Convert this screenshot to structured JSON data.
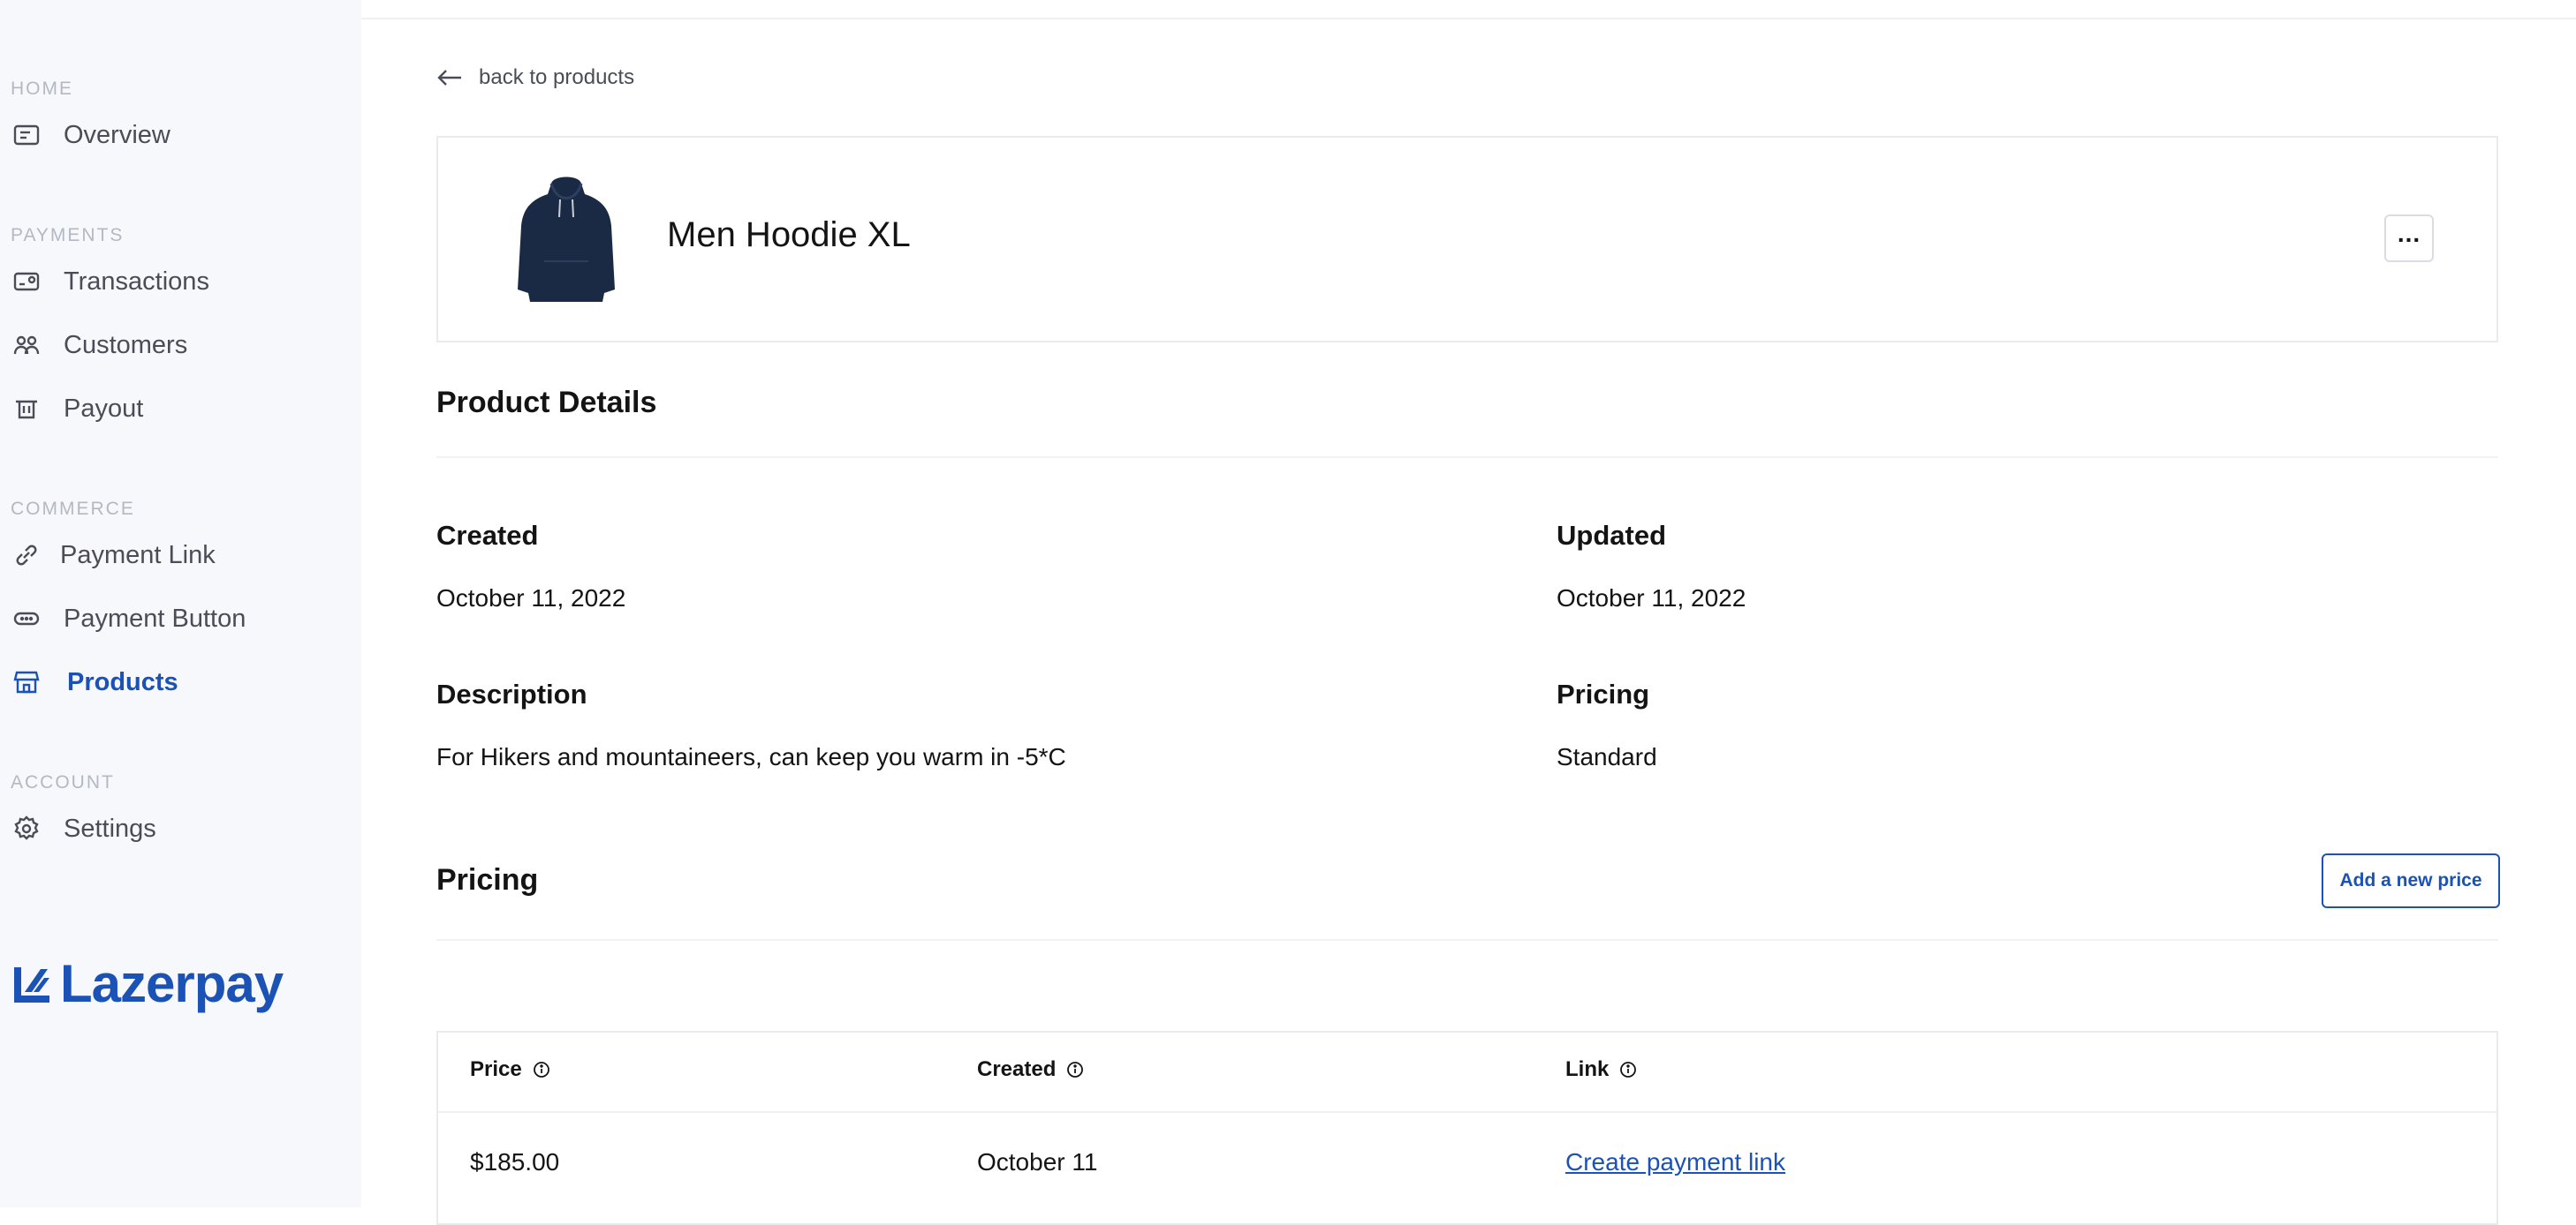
{
  "sidebar": {
    "sections": {
      "home": "HOME",
      "payments": "PAYMENTS",
      "commerce": "COMMERCE",
      "account": "ACCOUNT"
    },
    "items": {
      "overview": "Overview",
      "transactions": "Transactions",
      "customers": "Customers",
      "payout": "Payout",
      "payment_link": "Payment Link",
      "payment_button": "Payment Button",
      "products": "Products",
      "settings": "Settings"
    },
    "active_item": "Products",
    "logo_text": "Lazerpay"
  },
  "back_link": "back to products",
  "product": {
    "name": "Men Hoodie XL",
    "image": "navy-hoodie"
  },
  "details": {
    "heading": "Product Details",
    "created_label": "Created",
    "created_value": "October 11, 2022",
    "updated_label": "Updated",
    "updated_value": "October 11, 2022",
    "description_label": "Description",
    "description_value": "For Hikers and mountaineers, can keep you warm in -5*C",
    "pricing_label": "Pricing",
    "pricing_value": "Standard"
  },
  "pricing": {
    "heading": "Pricing",
    "add_button": "Add a new price",
    "columns": [
      "Price",
      "Created",
      "Link"
    ],
    "rows": [
      {
        "price": "$185.00",
        "created": "October 11",
        "link": "Create payment link"
      }
    ]
  },
  "colors": {
    "accent": "#1b52b5",
    "sidebar_bg": "#f7f8fc",
    "muted_label": "#b4b8c2"
  }
}
